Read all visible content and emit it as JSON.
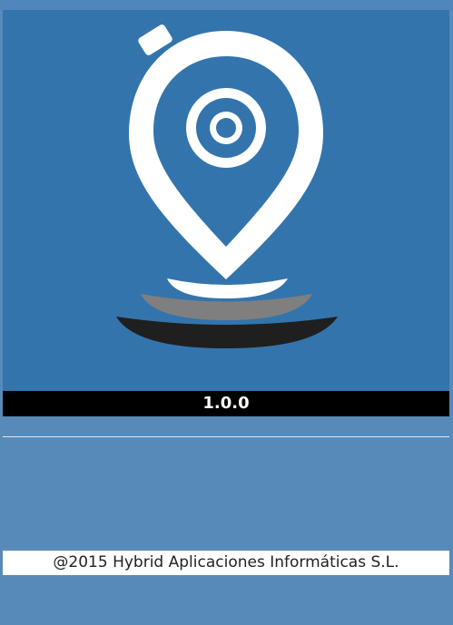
{
  "app": {
    "logo_icon": "map-pin-with-ripples-icon"
  },
  "version": {
    "label": "1.0.0"
  },
  "footer": {
    "copyright": "@2015 Hybrid Aplicaciones Informáticas S.L."
  },
  "colors": {
    "background": "#578ab9",
    "logo_panel": "#3374ad",
    "version_bar": "#000000",
    "version_text": "#ffffff",
    "copyright_bar": "#ffffff",
    "copyright_text": "#222222",
    "ripple_light": "#ffffff",
    "ripple_mid": "#7f7f7f",
    "ripple_dark": "#1f1f1f"
  }
}
